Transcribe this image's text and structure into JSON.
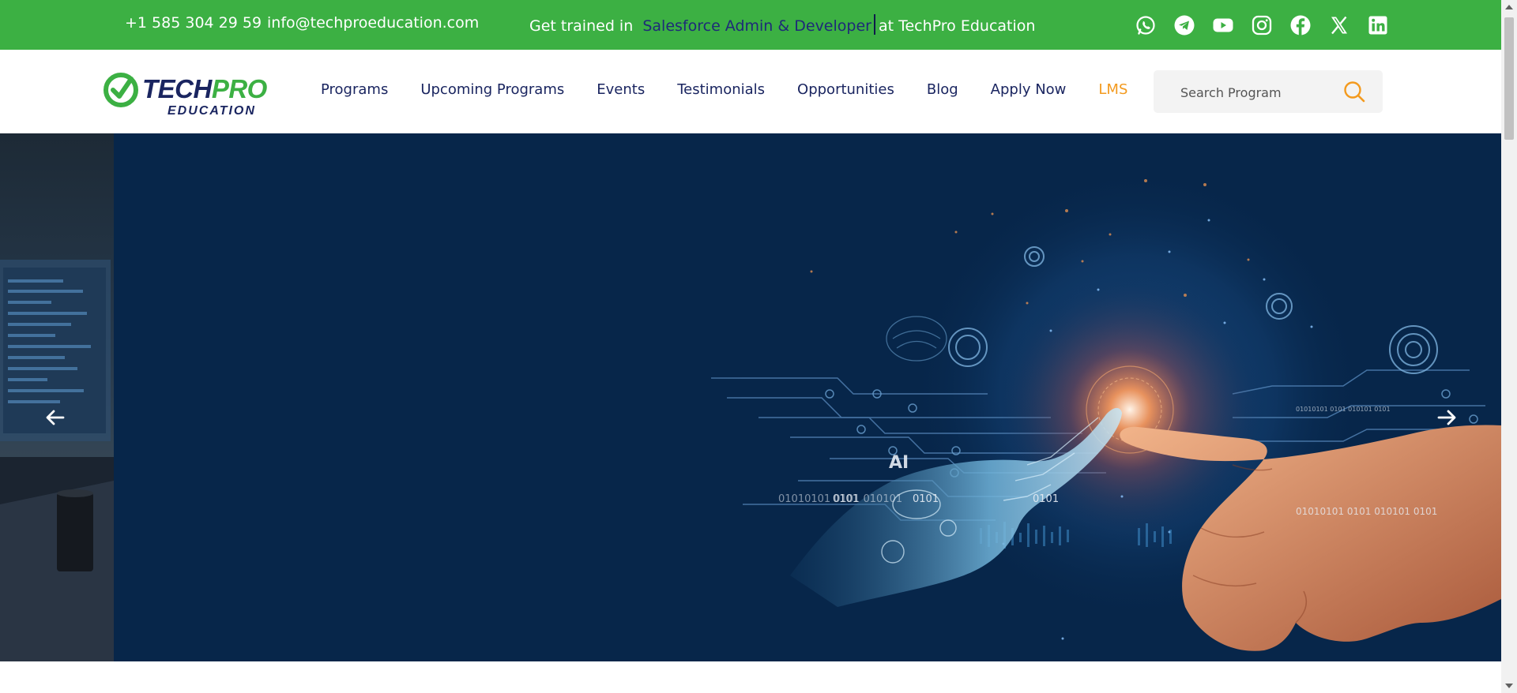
{
  "topbar": {
    "phone": "+1 585 304 29 59",
    "email": "info@techproeducation.com",
    "promo_prefix": "Get trained in",
    "promo_highlight": "Salesforce Admin & Developer",
    "promo_suffix": "at TechPro Education",
    "social_icons": [
      "whatsapp-icon",
      "telegram-icon",
      "youtube-icon",
      "instagram-icon",
      "facebook-icon",
      "x-icon",
      "linkedin-icon"
    ],
    "colors": {
      "background": "#3cb043",
      "highlight": "#1e2a78"
    }
  },
  "logo": {
    "brand_part1": "TECH",
    "brand_part2": "PRO",
    "sub": "EDUCATION"
  },
  "nav": {
    "items": [
      "Programs",
      "Upcoming Programs",
      "Events",
      "Testimonials",
      "Opportunities",
      "Blog",
      "Apply Now",
      "LMS"
    ],
    "colors": {
      "default": "#1a2560",
      "lms": "#f39a1e"
    }
  },
  "search": {
    "placeholder": "Search Program",
    "icon": "search-icon",
    "accent": "#f39a1e"
  },
  "hero": {
    "overlay_text": "AI",
    "binary_texts": [
      "01010101 0101 010101",
      "0101",
      "0101",
      "0101",
      "01010101 0101 010101 0101",
      "01010101 0101 010101 0101"
    ],
    "background": "#07264a"
  }
}
